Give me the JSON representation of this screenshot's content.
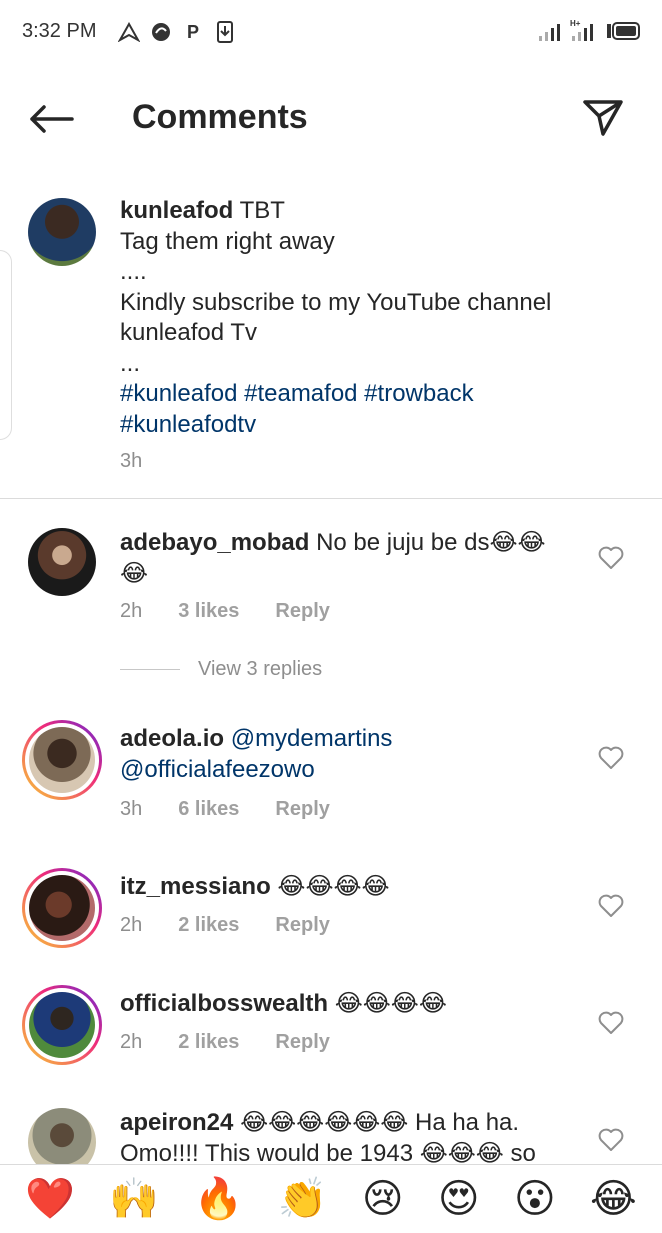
{
  "status_bar": {
    "time": "3:32 PM",
    "icons": [
      "navigation-icon",
      "hand-icon",
      "P",
      "download-icon"
    ]
  },
  "header": {
    "title": "Comments"
  },
  "caption": {
    "username": "kunleafod",
    "lines": [
      "TBT",
      "Tag them right away",
      "....",
      "Kindly subscribe to my YouTube channel",
      "kunleafod Tv",
      "..."
    ],
    "hashtags_line1": "#kunleafod #teamafod #trowback",
    "hashtags_line2": "#kunleafodtv",
    "time": "3h"
  },
  "comments": [
    {
      "username": "adebayo_mobad",
      "text": "No be juju be ds😂😂",
      "text2": "😂",
      "time": "2h",
      "likes": "3 likes",
      "reply": "Reply"
    },
    {
      "username": "adeola.io",
      "text": "@mydemartins",
      "text2": "@officialafeezowo",
      "time": "3h",
      "likes": "6 likes",
      "reply": "Reply"
    },
    {
      "username": "itz_messiano",
      "text": "😂😂😂😂",
      "time": "2h",
      "likes": "2 likes",
      "reply": "Reply"
    },
    {
      "username": "officialbosswealth",
      "text": "😂😂😂😂",
      "time": "2h",
      "likes": "2 likes",
      "reply": "Reply"
    },
    {
      "username": "apeiron24",
      "text": "😂😂😂😂😂😂 Ha ha ha.",
      "text2": "Omo!!!! This would be 1943 😂😂😂 so"
    }
  ],
  "view_replies": "View 3 replies",
  "emoji_bar": [
    "❤️",
    "🙌",
    "🔥",
    "👏",
    "😢",
    "😍",
    "😮",
    "😂"
  ]
}
